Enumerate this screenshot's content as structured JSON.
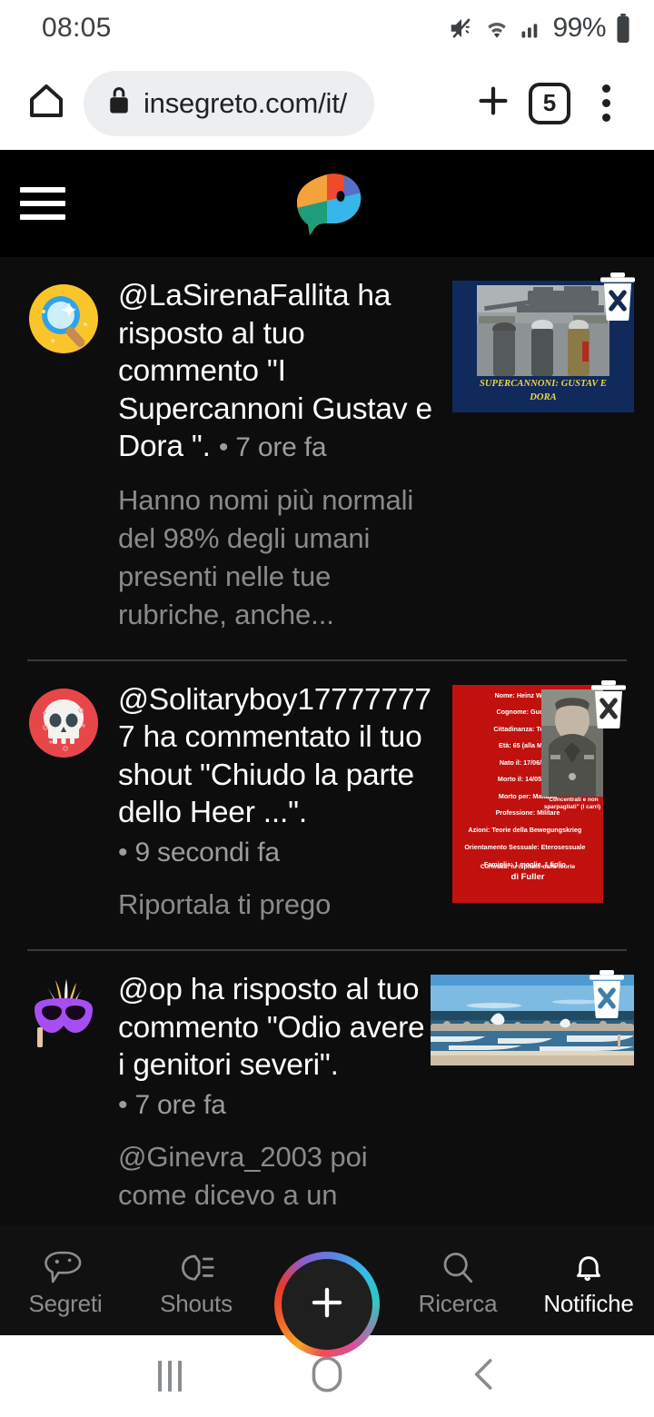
{
  "status_bar": {
    "time": "08:05",
    "battery_percent": "99%",
    "icons": [
      "mute-icon",
      "wifi-icon",
      "signal-icon",
      "battery-icon"
    ]
  },
  "browser": {
    "home_icon": "home-icon",
    "lock_icon": "lock-icon",
    "url": "insegreto.com/it/",
    "new_tab_icon": "plus-icon",
    "tab_count": "5",
    "menu_icon": "kebab-menu-icon"
  },
  "app_header": {
    "menu_icon": "hamburger-menu-icon",
    "logo": "insegreto-logo"
  },
  "notifications": [
    {
      "avatar": "magnifying-glass-avatar",
      "title_main": "@LaSirenaFallita ha risposto al tuo commento \"I Supercannoni Gustav e Dora \".",
      "timestamp": "• 7 ore fa",
      "preview": "Hanno nomi più normali del 98% degli umani presenti nelle tue rubriche, anche...",
      "thumbnail": {
        "type": "poster",
        "caption_line1": "SUPERCANNONI: GUSTAV E",
        "caption_line2": "DORA",
        "background_color": "#102a5c",
        "caption_color": "#f2d642"
      },
      "delete_icon": "delete-trash-icon"
    },
    {
      "avatar": "skull-avatar",
      "title_main": "@Solitaryboy177777777 ha commentato il tuo shout \"Chiudo la parte dello Heer ...\".",
      "timestamp": "• 9 secondi fa",
      "preview": "Riportala ti prego",
      "thumbnail": {
        "type": "info-card",
        "background_color": "#c1110f",
        "rows": [
          "Nome: Heinz Whilelm",
          "Cognome: Guderian",
          "Cittadinanza: Tedesca",
          "Età: 65 (alla Morte)",
          "Nato il: 17/06/1888",
          "Morto il: 14/05/1954",
          "Morto per: Malattia",
          "Professione: Militare",
          "Azioni: Teorie della Bewegungskrieg",
          "Orientamento Sessuale: Eterosessuale",
          "Famiglia: 1 moglie, 1 figlio"
        ],
        "quote": "\"Concentrati e non sparpagliati\" (I carri)",
        "curiosity_line1": "Curiosità: fu ispirato dalle teorie",
        "curiosity_line2": "di Fuller"
      },
      "delete_icon": "delete-trash-icon"
    },
    {
      "avatar": "carnival-mask-avatar",
      "title_main": "@op ha risposto al tuo commento \"Odio avere i genitori severi\".",
      "timestamp": "• 7 ore fa",
      "preview": "@Ginevra_2003 poi come dicevo a un",
      "thumbnail": {
        "type": "photo",
        "description": "beach-seascape"
      },
      "delete_icon": "delete-trash-icon"
    }
  ],
  "bottom_nav": {
    "items": [
      {
        "label": "Segreti",
        "icon": "speech-bubble-icon",
        "active": false
      },
      {
        "label": "Shouts",
        "icon": "megaphone-icon",
        "active": false
      },
      {
        "label": "Ricerca",
        "icon": "search-icon",
        "active": false
      },
      {
        "label": "Notifiche",
        "icon": "bell-icon",
        "active": true
      }
    ],
    "create_button_icon": "plus-icon"
  },
  "android_nav": {
    "recents_icon": "recents-icon",
    "home_icon": "home-circle-icon",
    "back_icon": "back-chevron-icon"
  },
  "colors": {
    "page_background": "#0d0d0d",
    "header_background": "#000000",
    "accent_active": "#ffffff",
    "muted_text": "#8a8a8a"
  }
}
